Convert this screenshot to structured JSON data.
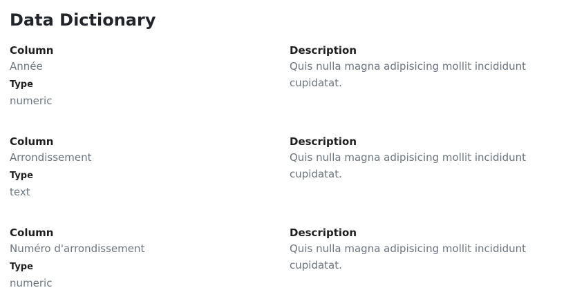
{
  "page_title": "Data Dictionary",
  "entries": [
    {
      "column_label": "Column",
      "column_value": "Année",
      "type_label": "Type",
      "type_value": "numeric",
      "description_label": "Description",
      "description_value": "Quis nulla magna adipisicing mollit incididunt cupidatat."
    },
    {
      "column_label": "Column",
      "column_value": "Arrondissement",
      "type_label": "Type",
      "type_value": "text",
      "description_label": "Description",
      "description_value": "Quis nulla magna adipisicing mollit incididunt cupidatat."
    },
    {
      "column_label": "Column",
      "column_value": "Numéro d'arrondissement",
      "type_label": "Type",
      "type_value": "numeric",
      "description_label": "Description",
      "description_value": "Quis nulla magna adipisicing mollit incididunt cupidatat."
    }
  ]
}
